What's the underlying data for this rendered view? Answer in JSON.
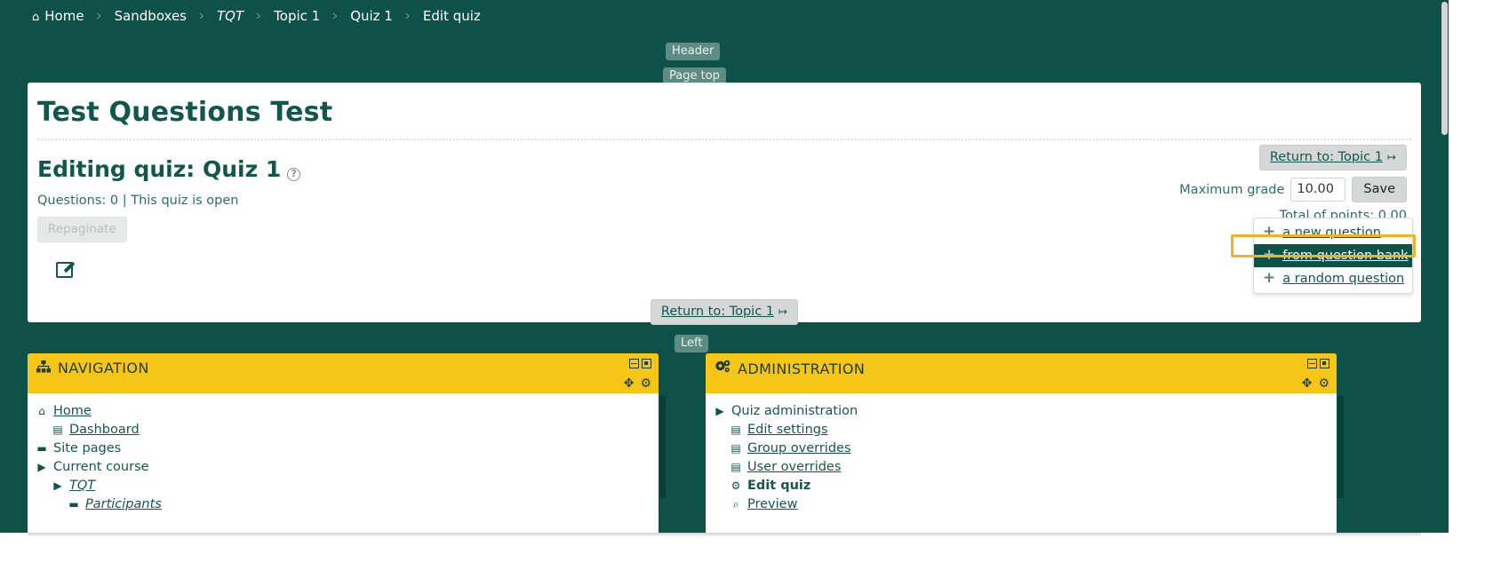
{
  "breadcrumb": {
    "items": [
      {
        "label": "Home",
        "icon": "home-icon",
        "italic": false
      },
      {
        "label": "Sandboxes",
        "icon": "",
        "italic": false
      },
      {
        "label": "TQT",
        "icon": "",
        "italic": true
      },
      {
        "label": "Topic 1",
        "icon": "",
        "italic": false
      },
      {
        "label": "Quiz 1",
        "icon": "",
        "italic": false
      },
      {
        "label": "Edit quiz",
        "icon": "",
        "italic": false
      }
    ],
    "separator": "›"
  },
  "regions": {
    "header": "Header",
    "page_top": "Page top",
    "left": "Left"
  },
  "main": {
    "site_title": "Test Questions Test",
    "heading": "Editing quiz: Quiz 1",
    "help_icon": "?",
    "meta": "Questions: 0 | This quiz is open",
    "repaginate_label": "Repaginate",
    "edit_icon": "edit-pencil-icon",
    "return_top_label": "Return to: Topic 1",
    "return_bottom_label": "Return to: Topic 1",
    "return_arrow": "↦",
    "maximum_grade_label": "Maximum grade",
    "maximum_grade_value": "10.00",
    "save_label": "Save",
    "total_points": "Total of points: 0.00"
  },
  "add_menu": {
    "items": [
      {
        "label": "a new question",
        "plus": "+",
        "selected": false
      },
      {
        "label": "from question bank",
        "plus": "+",
        "selected": true
      },
      {
        "label": "a random question",
        "plus": "+",
        "selected": false
      }
    ],
    "focus_color": "#f0b323"
  },
  "blocks": {
    "navigation": {
      "title": "NAVIGATION",
      "title_icon": "sitemap-icon",
      "collapse_icon": "collapse-icon",
      "dock_icon": "dock-icon",
      "move_icon": "✥",
      "settings_icon": "⚙",
      "items": [
        {
          "label": "Home",
          "icon": "",
          "indent": 0,
          "link": true,
          "italic": false,
          "bold": false,
          "ico_kind": "home"
        },
        {
          "label": "Dashboard",
          "icon": "",
          "indent": 1,
          "link": true,
          "italic": false,
          "bold": false,
          "ico_kind": "page"
        },
        {
          "label": "Site pages",
          "icon": "",
          "indent": 0,
          "link": false,
          "italic": false,
          "bold": false,
          "ico_kind": "folder"
        },
        {
          "label": "Current course",
          "icon": "",
          "indent": 0,
          "link": false,
          "italic": false,
          "bold": false,
          "ico_kind": "folder-open"
        },
        {
          "label": "TQT",
          "icon": "",
          "indent": 1,
          "link": true,
          "italic": true,
          "bold": false,
          "ico_kind": "folder-open"
        },
        {
          "label": "Participants",
          "icon": "",
          "indent": 2,
          "link": true,
          "italic": true,
          "bold": false,
          "ico_kind": "folder"
        }
      ]
    },
    "administration": {
      "title": "ADMINISTRATION",
      "title_icon": "gears-icon",
      "collapse_icon": "collapse-icon",
      "dock_icon": "dock-icon",
      "move_icon": "✥",
      "settings_icon": "⚙",
      "items": [
        {
          "label": "Quiz administration",
          "indent": 0,
          "link": false,
          "italic": false,
          "bold": false,
          "ico_kind": "folder-open"
        },
        {
          "label": "Edit settings",
          "indent": 1,
          "link": true,
          "italic": false,
          "bold": false,
          "ico_kind": "page"
        },
        {
          "label": "Group overrides",
          "indent": 1,
          "link": true,
          "italic": false,
          "bold": false,
          "ico_kind": "page"
        },
        {
          "label": "User overrides",
          "indent": 1,
          "link": true,
          "italic": false,
          "bold": false,
          "ico_kind": "page"
        },
        {
          "label": "Edit quiz",
          "indent": 1,
          "link": false,
          "italic": false,
          "bold": true,
          "ico_kind": "gear"
        },
        {
          "label": "Preview",
          "indent": 1,
          "link": true,
          "italic": false,
          "bold": false,
          "ico_kind": "search"
        }
      ]
    }
  },
  "colors": {
    "page_bg": "#0d5148",
    "block_header": "#f5c518",
    "link": "#17564e",
    "selected_bg": "#0d5148"
  }
}
